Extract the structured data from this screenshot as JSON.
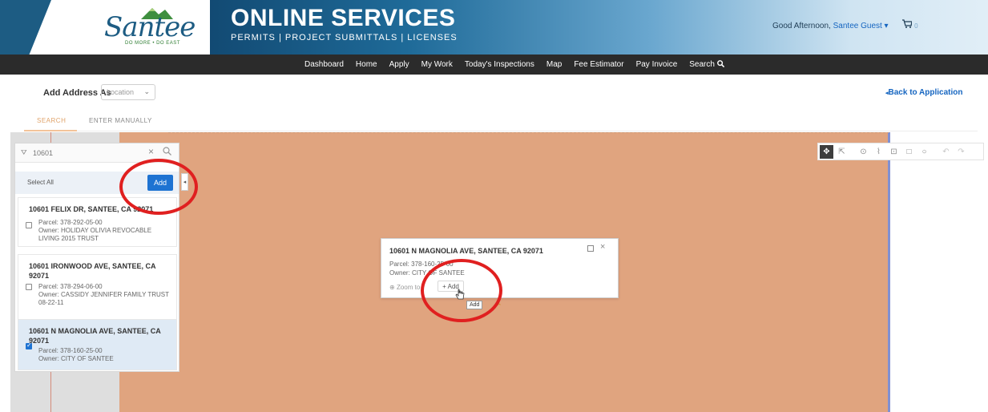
{
  "header": {
    "logo_text": "Santee",
    "logo_tagline": "DO MORE • DO EAST",
    "title": "ONLINE SERVICES",
    "subtitle": "PERMITS | PROJECT SUBMITTALS | LICENSES",
    "greeting": "Good Afternoon,",
    "user": "Santee Guest",
    "cart_count": "0"
  },
  "nav": {
    "items": [
      "Dashboard",
      "Home",
      "Apply",
      "My Work",
      "Today's Inspections",
      "Map",
      "Fee Estimator",
      "Pay Invoice",
      "Search"
    ]
  },
  "toolbar": {
    "add_address_label": "Add Address As",
    "address_type": "Location",
    "back_link": "Back to Application"
  },
  "tabs": [
    "SEARCH",
    "ENTER MANUALLY"
  ],
  "panel": {
    "search_value": "10601",
    "select_all": "Select All",
    "add_button": "Add",
    "results": [
      {
        "title": "10601 FELIX DR, SANTEE, CA 92071",
        "parcel": "Parcel: 378-292-05-00",
        "owner": "Owner: HOLIDAY OLIVIA REVOCABLE LIVING 2015 TRUST",
        "checked": false
      },
      {
        "title": "10601 IRONWOOD AVE, SANTEE, CA 92071",
        "parcel": "Parcel: 378-294-06-00",
        "owner": "Owner: CASSIDY JENNIFER FAMILY TRUST 08-22-11",
        "checked": false
      },
      {
        "title": "10601 N MAGNOLIA AVE, SANTEE, CA 92071",
        "parcel": "Parcel: 378-160-25-00",
        "owner": "Owner: CITY OF SANTEE",
        "checked": true
      }
    ]
  },
  "popup": {
    "title": "10601 N MAGNOLIA AVE, SANTEE, CA 92071",
    "parcel": "Parcel: 378-160-25-00",
    "owner": "Owner: CITY OF SANTEE",
    "zoom_label": "Zoom to",
    "add_label": "+ Add",
    "tooltip": "Add"
  },
  "map_tools": [
    "pan-icon",
    "select-icon",
    "pin-icon",
    "polyline-icon",
    "edit-polygon-icon",
    "rectangle-icon",
    "circle-icon",
    "undo-icon",
    "redo-icon"
  ],
  "colors": {
    "header_blue": "#1d5c83",
    "nav_bg": "#2b2b2b",
    "map_fill": "#e0a47f",
    "accent_blue": "#1e73d2",
    "tab_active": "#e0a36a",
    "annotation_red": "#e02020"
  }
}
